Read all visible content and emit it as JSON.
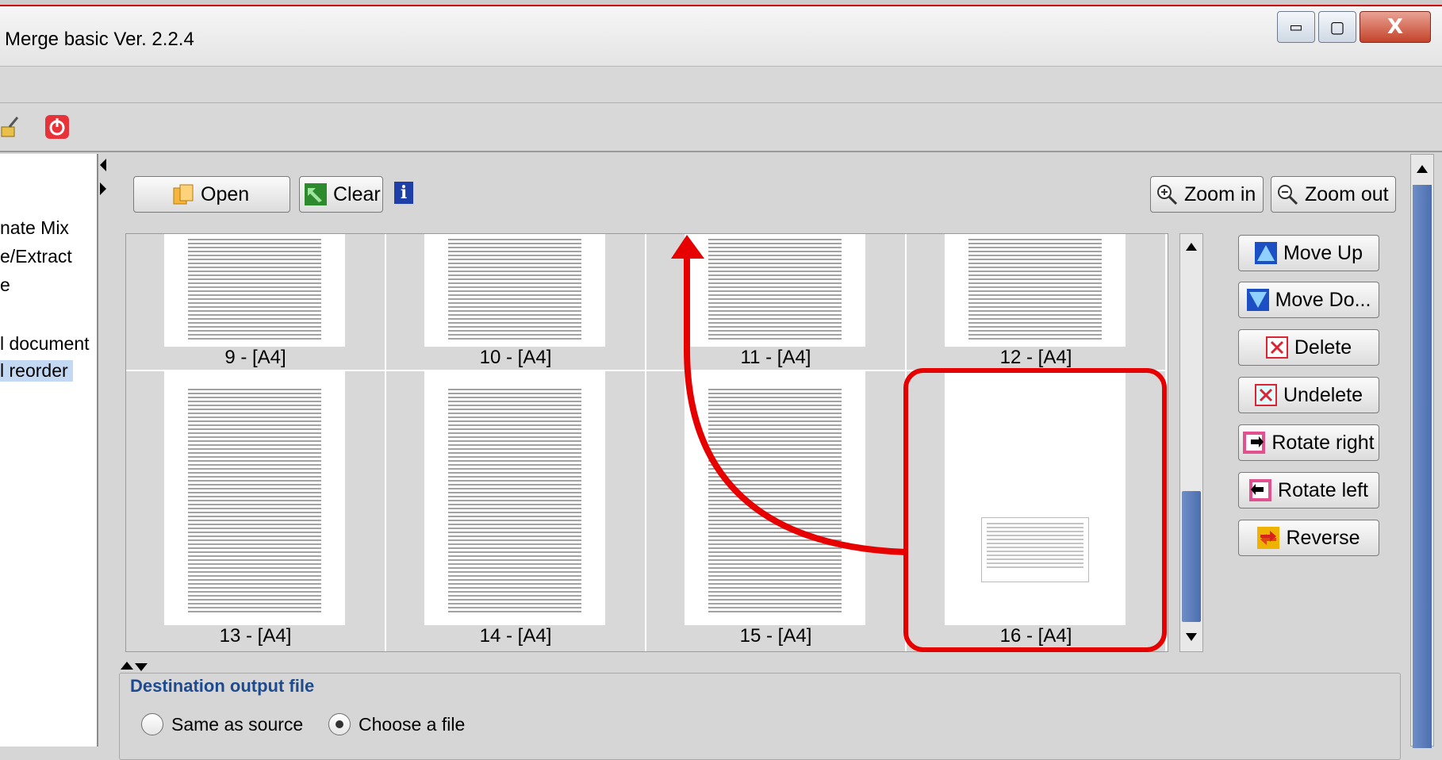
{
  "window": {
    "title": "Merge basic Ver. 2.2.4",
    "minimize_glyph": "▭",
    "maximize_glyph": "▢",
    "close_glyph": "X"
  },
  "toolbar": {
    "icons": [
      "broom-icon",
      "power-icon"
    ]
  },
  "sidebar": {
    "items": [
      {
        "label": "nate Mix",
        "selected": false
      },
      {
        "label": "e/Extract",
        "selected": false
      },
      {
        "label": "e",
        "selected": false
      },
      {
        "label": "l document",
        "selected": false
      },
      {
        "label": "l reorder",
        "selected": true
      }
    ]
  },
  "top_buttons": {
    "open": "Open",
    "clear": "Clear",
    "info": "i",
    "zoom_in": "Zoom in",
    "zoom_out": "Zoom out"
  },
  "pages": [
    {
      "caption": "9 - [A4]"
    },
    {
      "caption": "10 - [A4]"
    },
    {
      "caption": "11 - [A4]"
    },
    {
      "caption": "12 - [A4]"
    },
    {
      "caption": "13 - [A4]"
    },
    {
      "caption": "14 - [A4]"
    },
    {
      "caption": "15 - [A4]"
    },
    {
      "caption": "16 - [A4]"
    }
  ],
  "side_buttons": {
    "move_up": "Move Up",
    "move_down": "Move Do...",
    "delete": "Delete",
    "undelete": "Undelete",
    "rotate_right": "Rotate right",
    "rotate_left": "Rotate left",
    "reverse": "Reverse"
  },
  "destination": {
    "legend": "Destination output file",
    "same_as_source": "Same as source",
    "choose_file": "Choose a file",
    "selected_option": "choose_file"
  },
  "colors": {
    "annotation": "#e60000",
    "accent_blue": "#4c6fb0",
    "legend_text": "#1e4b8f",
    "selection": "#c3d9f3"
  }
}
